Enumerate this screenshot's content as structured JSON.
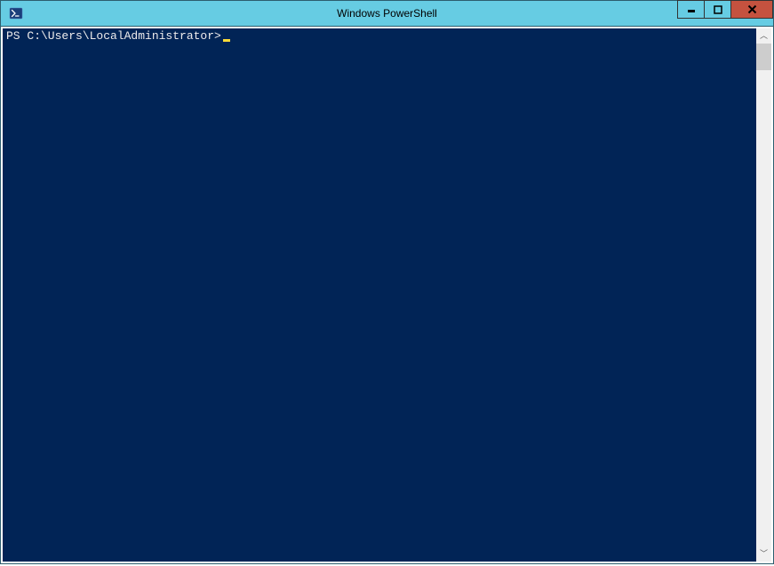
{
  "window": {
    "title": "Windows PowerShell",
    "icon_name": "powershell-icon"
  },
  "console": {
    "prompt": "PS C:\\Users\\LocalAdministrator>",
    "input_value": "",
    "cursor_visible": true
  },
  "colors": {
    "titlebar_bg": "#66cce3",
    "console_bg": "#012456",
    "prompt_text": "#eeecec",
    "cursor": "#fedb38",
    "close_btn": "#c5523f"
  }
}
